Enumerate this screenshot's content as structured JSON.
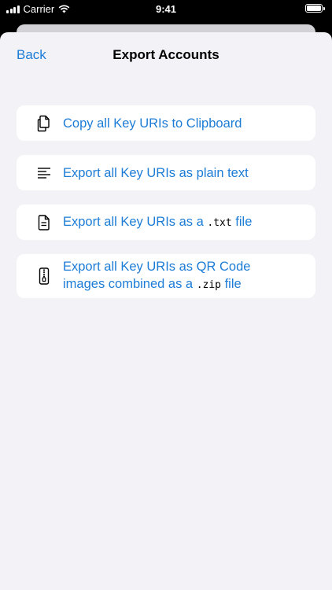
{
  "status_bar": {
    "carrier": "Carrier",
    "time": "9:41"
  },
  "nav": {
    "back_label": "Back",
    "title": "Export Accounts"
  },
  "options": [
    {
      "icon": "copy-documents-icon",
      "text": "Copy all Key URIs to Clipboard"
    },
    {
      "icon": "text-lines-icon",
      "text": "Export all Key URIs as plain text"
    },
    {
      "icon": "document-icon",
      "text_before": "Export all Key URIs as a ",
      "code": ".txt",
      "text_after": " file"
    },
    {
      "icon": "zip-archive-icon",
      "text_line1": "Export all Key URIs as QR Code",
      "text_before": "images combined as a ",
      "code": ".zip",
      "text_after": " file"
    }
  ],
  "colors": {
    "accent": "#1c7cd6",
    "background": "#f2f2f7",
    "card": "#ffffff"
  }
}
